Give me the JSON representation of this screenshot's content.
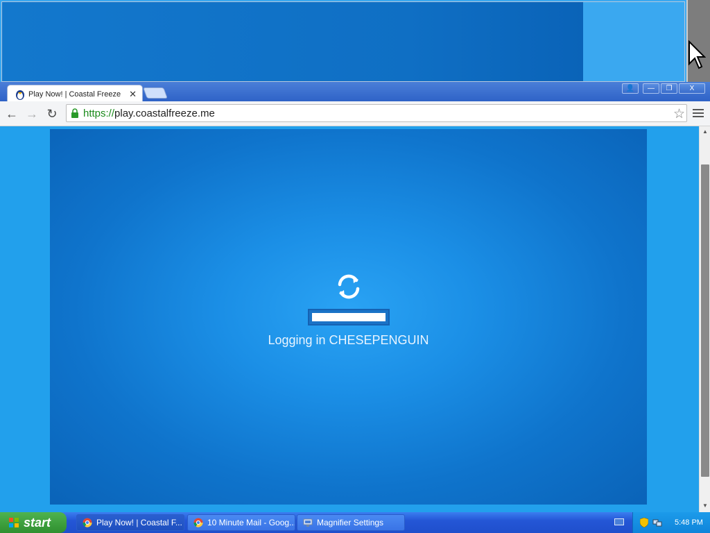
{
  "browser": {
    "tab": {
      "title": "Play Now! | Coastal Freeze",
      "close": "✕"
    },
    "window_buttons": {
      "user": "👤",
      "minimize": "—",
      "restore": "❐",
      "close": "X"
    },
    "toolbar": {
      "back": "←",
      "forward": "→",
      "reload": "↻"
    },
    "address": {
      "scheme": "https://",
      "host": "play.coastalfreeze.me",
      "star": "☆"
    }
  },
  "game": {
    "status_text": "Logging in CHESEPENGUIN",
    "progress_fraction": 1.0
  },
  "taskbar": {
    "start_label": "start",
    "tasks": [
      {
        "label": "Play Now! | Coastal F..."
      },
      {
        "label": "10 Minute Mail - Goog..."
      },
      {
        "label": "Magnifier Settings"
      }
    ],
    "clock": "5:48 PM"
  },
  "colors": {
    "accent": "#1b8fe6",
    "taskbar": "#2456d6",
    "start": "#3a9b3a"
  }
}
